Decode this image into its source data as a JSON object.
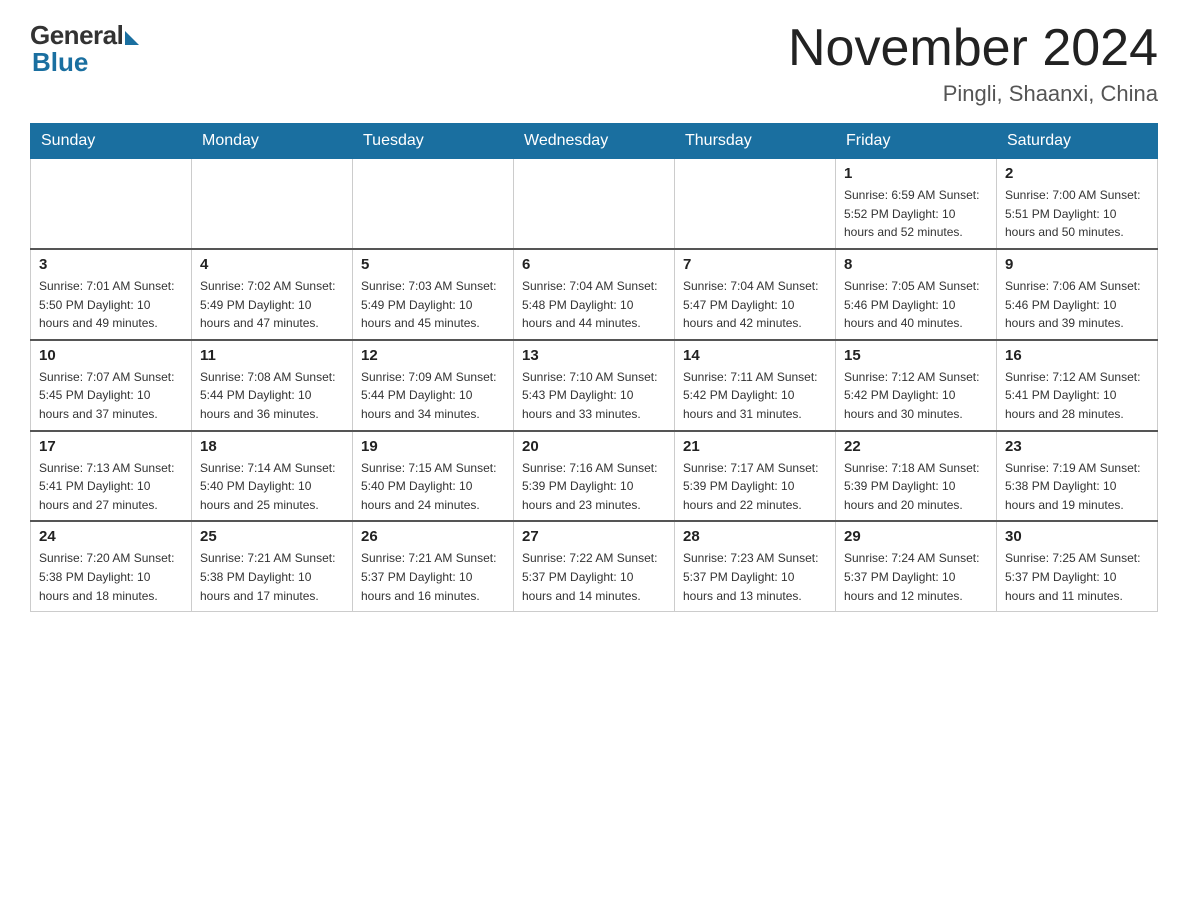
{
  "header": {
    "logo_general": "General",
    "logo_blue": "Blue",
    "month_year": "November 2024",
    "location": "Pingli, Shaanxi, China"
  },
  "weekdays": [
    "Sunday",
    "Monday",
    "Tuesday",
    "Wednesday",
    "Thursday",
    "Friday",
    "Saturday"
  ],
  "weeks": [
    [
      {
        "day": "",
        "info": ""
      },
      {
        "day": "",
        "info": ""
      },
      {
        "day": "",
        "info": ""
      },
      {
        "day": "",
        "info": ""
      },
      {
        "day": "",
        "info": ""
      },
      {
        "day": "1",
        "info": "Sunrise: 6:59 AM\nSunset: 5:52 PM\nDaylight: 10 hours\nand 52 minutes."
      },
      {
        "day": "2",
        "info": "Sunrise: 7:00 AM\nSunset: 5:51 PM\nDaylight: 10 hours\nand 50 minutes."
      }
    ],
    [
      {
        "day": "3",
        "info": "Sunrise: 7:01 AM\nSunset: 5:50 PM\nDaylight: 10 hours\nand 49 minutes."
      },
      {
        "day": "4",
        "info": "Sunrise: 7:02 AM\nSunset: 5:49 PM\nDaylight: 10 hours\nand 47 minutes."
      },
      {
        "day": "5",
        "info": "Sunrise: 7:03 AM\nSunset: 5:49 PM\nDaylight: 10 hours\nand 45 minutes."
      },
      {
        "day": "6",
        "info": "Sunrise: 7:04 AM\nSunset: 5:48 PM\nDaylight: 10 hours\nand 44 minutes."
      },
      {
        "day": "7",
        "info": "Sunrise: 7:04 AM\nSunset: 5:47 PM\nDaylight: 10 hours\nand 42 minutes."
      },
      {
        "day": "8",
        "info": "Sunrise: 7:05 AM\nSunset: 5:46 PM\nDaylight: 10 hours\nand 40 minutes."
      },
      {
        "day": "9",
        "info": "Sunrise: 7:06 AM\nSunset: 5:46 PM\nDaylight: 10 hours\nand 39 minutes."
      }
    ],
    [
      {
        "day": "10",
        "info": "Sunrise: 7:07 AM\nSunset: 5:45 PM\nDaylight: 10 hours\nand 37 minutes."
      },
      {
        "day": "11",
        "info": "Sunrise: 7:08 AM\nSunset: 5:44 PM\nDaylight: 10 hours\nand 36 minutes."
      },
      {
        "day": "12",
        "info": "Sunrise: 7:09 AM\nSunset: 5:44 PM\nDaylight: 10 hours\nand 34 minutes."
      },
      {
        "day": "13",
        "info": "Sunrise: 7:10 AM\nSunset: 5:43 PM\nDaylight: 10 hours\nand 33 minutes."
      },
      {
        "day": "14",
        "info": "Sunrise: 7:11 AM\nSunset: 5:42 PM\nDaylight: 10 hours\nand 31 minutes."
      },
      {
        "day": "15",
        "info": "Sunrise: 7:12 AM\nSunset: 5:42 PM\nDaylight: 10 hours\nand 30 minutes."
      },
      {
        "day": "16",
        "info": "Sunrise: 7:12 AM\nSunset: 5:41 PM\nDaylight: 10 hours\nand 28 minutes."
      }
    ],
    [
      {
        "day": "17",
        "info": "Sunrise: 7:13 AM\nSunset: 5:41 PM\nDaylight: 10 hours\nand 27 minutes."
      },
      {
        "day": "18",
        "info": "Sunrise: 7:14 AM\nSunset: 5:40 PM\nDaylight: 10 hours\nand 25 minutes."
      },
      {
        "day": "19",
        "info": "Sunrise: 7:15 AM\nSunset: 5:40 PM\nDaylight: 10 hours\nand 24 minutes."
      },
      {
        "day": "20",
        "info": "Sunrise: 7:16 AM\nSunset: 5:39 PM\nDaylight: 10 hours\nand 23 minutes."
      },
      {
        "day": "21",
        "info": "Sunrise: 7:17 AM\nSunset: 5:39 PM\nDaylight: 10 hours\nand 22 minutes."
      },
      {
        "day": "22",
        "info": "Sunrise: 7:18 AM\nSunset: 5:39 PM\nDaylight: 10 hours\nand 20 minutes."
      },
      {
        "day": "23",
        "info": "Sunrise: 7:19 AM\nSunset: 5:38 PM\nDaylight: 10 hours\nand 19 minutes."
      }
    ],
    [
      {
        "day": "24",
        "info": "Sunrise: 7:20 AM\nSunset: 5:38 PM\nDaylight: 10 hours\nand 18 minutes."
      },
      {
        "day": "25",
        "info": "Sunrise: 7:21 AM\nSunset: 5:38 PM\nDaylight: 10 hours\nand 17 minutes."
      },
      {
        "day": "26",
        "info": "Sunrise: 7:21 AM\nSunset: 5:37 PM\nDaylight: 10 hours\nand 16 minutes."
      },
      {
        "day": "27",
        "info": "Sunrise: 7:22 AM\nSunset: 5:37 PM\nDaylight: 10 hours\nand 14 minutes."
      },
      {
        "day": "28",
        "info": "Sunrise: 7:23 AM\nSunset: 5:37 PM\nDaylight: 10 hours\nand 13 minutes."
      },
      {
        "day": "29",
        "info": "Sunrise: 7:24 AM\nSunset: 5:37 PM\nDaylight: 10 hours\nand 12 minutes."
      },
      {
        "day": "30",
        "info": "Sunrise: 7:25 AM\nSunset: 5:37 PM\nDaylight: 10 hours\nand 11 minutes."
      }
    ]
  ]
}
